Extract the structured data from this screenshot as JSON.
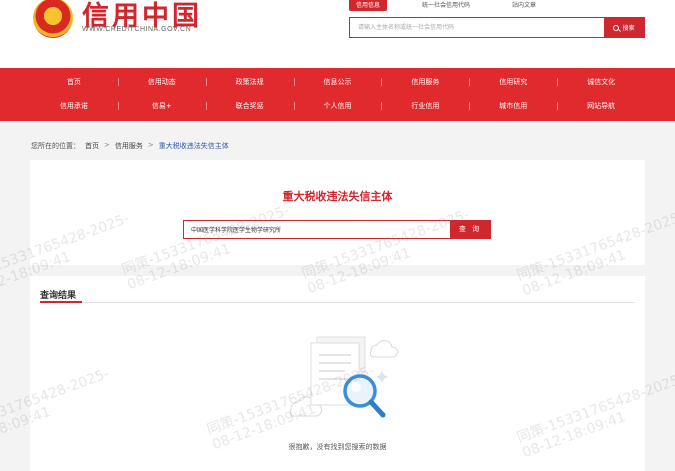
{
  "header": {
    "site_title": "信用中国",
    "site_url": "WWW.CREDITCHINA.GOV.CN",
    "search_tabs": [
      {
        "label": "信用信息",
        "active": true
      },
      {
        "label": "统一社会信用代码",
        "active": false
      },
      {
        "label": "站内文章",
        "active": false
      }
    ],
    "search_placeholder": "请输入主体名称或统一社会信用代码",
    "search_button": "搜索"
  },
  "nav": {
    "row1": [
      "首页",
      "信用动态",
      "政策法规",
      "信息公示",
      "信用服务",
      "信用研究",
      "诚信文化"
    ],
    "row2": [
      "信用承诺",
      "信易+",
      "联合奖惩",
      "个人信用",
      "行业信用",
      "城市信用",
      "网站导航"
    ]
  },
  "breadcrumb": {
    "prefix": "您所在的位置：",
    "items": [
      "首页",
      "信用服务",
      "重大税收违法失信主体"
    ],
    "separator": ">"
  },
  "query": {
    "title": "重大税收违法失信主体",
    "input_value": "中国医学科学院医学生物学研究所",
    "button_label": "查 询"
  },
  "results": {
    "title": "查询结果",
    "empty_message": "很抱歉，没有找到您搜索的数据"
  },
  "watermark": {
    "line1": "同策-15331765428-2025-",
    "line2": "08-12-18:09:41"
  },
  "colors": {
    "brand_red": "#d0262d",
    "nav_red": "#e02a2d",
    "link_blue": "#2b5aa8"
  }
}
